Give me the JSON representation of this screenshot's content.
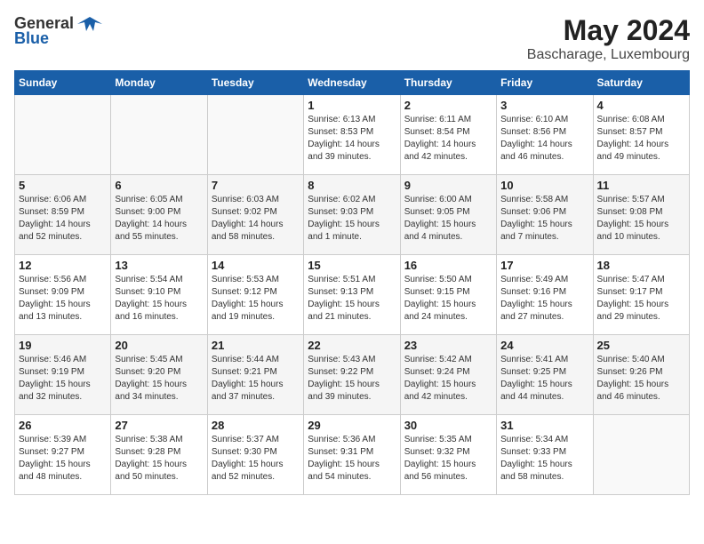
{
  "logo": {
    "general": "General",
    "blue": "Blue"
  },
  "title": {
    "month_year": "May 2024",
    "location": "Bascharage, Luxembourg"
  },
  "days_of_week": [
    "Sunday",
    "Monday",
    "Tuesday",
    "Wednesday",
    "Thursday",
    "Friday",
    "Saturday"
  ],
  "weeks": [
    [
      {
        "day": "",
        "info": ""
      },
      {
        "day": "",
        "info": ""
      },
      {
        "day": "",
        "info": ""
      },
      {
        "day": "1",
        "info": "Sunrise: 6:13 AM\nSunset: 8:53 PM\nDaylight: 14 hours\nand 39 minutes."
      },
      {
        "day": "2",
        "info": "Sunrise: 6:11 AM\nSunset: 8:54 PM\nDaylight: 14 hours\nand 42 minutes."
      },
      {
        "day": "3",
        "info": "Sunrise: 6:10 AM\nSunset: 8:56 PM\nDaylight: 14 hours\nand 46 minutes."
      },
      {
        "day": "4",
        "info": "Sunrise: 6:08 AM\nSunset: 8:57 PM\nDaylight: 14 hours\nand 49 minutes."
      }
    ],
    [
      {
        "day": "5",
        "info": "Sunrise: 6:06 AM\nSunset: 8:59 PM\nDaylight: 14 hours\nand 52 minutes."
      },
      {
        "day": "6",
        "info": "Sunrise: 6:05 AM\nSunset: 9:00 PM\nDaylight: 14 hours\nand 55 minutes."
      },
      {
        "day": "7",
        "info": "Sunrise: 6:03 AM\nSunset: 9:02 PM\nDaylight: 14 hours\nand 58 minutes."
      },
      {
        "day": "8",
        "info": "Sunrise: 6:02 AM\nSunset: 9:03 PM\nDaylight: 15 hours\nand 1 minute."
      },
      {
        "day": "9",
        "info": "Sunrise: 6:00 AM\nSunset: 9:05 PM\nDaylight: 15 hours\nand 4 minutes."
      },
      {
        "day": "10",
        "info": "Sunrise: 5:58 AM\nSunset: 9:06 PM\nDaylight: 15 hours\nand 7 minutes."
      },
      {
        "day": "11",
        "info": "Sunrise: 5:57 AM\nSunset: 9:08 PM\nDaylight: 15 hours\nand 10 minutes."
      }
    ],
    [
      {
        "day": "12",
        "info": "Sunrise: 5:56 AM\nSunset: 9:09 PM\nDaylight: 15 hours\nand 13 minutes."
      },
      {
        "day": "13",
        "info": "Sunrise: 5:54 AM\nSunset: 9:10 PM\nDaylight: 15 hours\nand 16 minutes."
      },
      {
        "day": "14",
        "info": "Sunrise: 5:53 AM\nSunset: 9:12 PM\nDaylight: 15 hours\nand 19 minutes."
      },
      {
        "day": "15",
        "info": "Sunrise: 5:51 AM\nSunset: 9:13 PM\nDaylight: 15 hours\nand 21 minutes."
      },
      {
        "day": "16",
        "info": "Sunrise: 5:50 AM\nSunset: 9:15 PM\nDaylight: 15 hours\nand 24 minutes."
      },
      {
        "day": "17",
        "info": "Sunrise: 5:49 AM\nSunset: 9:16 PM\nDaylight: 15 hours\nand 27 minutes."
      },
      {
        "day": "18",
        "info": "Sunrise: 5:47 AM\nSunset: 9:17 PM\nDaylight: 15 hours\nand 29 minutes."
      }
    ],
    [
      {
        "day": "19",
        "info": "Sunrise: 5:46 AM\nSunset: 9:19 PM\nDaylight: 15 hours\nand 32 minutes."
      },
      {
        "day": "20",
        "info": "Sunrise: 5:45 AM\nSunset: 9:20 PM\nDaylight: 15 hours\nand 34 minutes."
      },
      {
        "day": "21",
        "info": "Sunrise: 5:44 AM\nSunset: 9:21 PM\nDaylight: 15 hours\nand 37 minutes."
      },
      {
        "day": "22",
        "info": "Sunrise: 5:43 AM\nSunset: 9:22 PM\nDaylight: 15 hours\nand 39 minutes."
      },
      {
        "day": "23",
        "info": "Sunrise: 5:42 AM\nSunset: 9:24 PM\nDaylight: 15 hours\nand 42 minutes."
      },
      {
        "day": "24",
        "info": "Sunrise: 5:41 AM\nSunset: 9:25 PM\nDaylight: 15 hours\nand 44 minutes."
      },
      {
        "day": "25",
        "info": "Sunrise: 5:40 AM\nSunset: 9:26 PM\nDaylight: 15 hours\nand 46 minutes."
      }
    ],
    [
      {
        "day": "26",
        "info": "Sunrise: 5:39 AM\nSunset: 9:27 PM\nDaylight: 15 hours\nand 48 minutes."
      },
      {
        "day": "27",
        "info": "Sunrise: 5:38 AM\nSunset: 9:28 PM\nDaylight: 15 hours\nand 50 minutes."
      },
      {
        "day": "28",
        "info": "Sunrise: 5:37 AM\nSunset: 9:30 PM\nDaylight: 15 hours\nand 52 minutes."
      },
      {
        "day": "29",
        "info": "Sunrise: 5:36 AM\nSunset: 9:31 PM\nDaylight: 15 hours\nand 54 minutes."
      },
      {
        "day": "30",
        "info": "Sunrise: 5:35 AM\nSunset: 9:32 PM\nDaylight: 15 hours\nand 56 minutes."
      },
      {
        "day": "31",
        "info": "Sunrise: 5:34 AM\nSunset: 9:33 PM\nDaylight: 15 hours\nand 58 minutes."
      },
      {
        "day": "",
        "info": ""
      }
    ]
  ]
}
